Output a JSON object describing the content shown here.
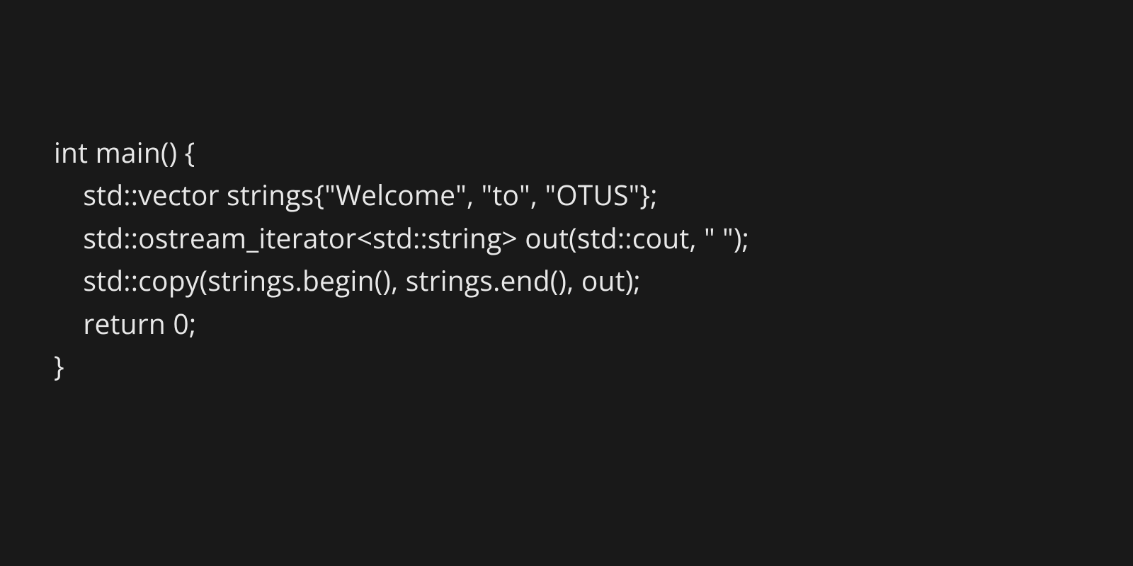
{
  "code": {
    "line1": "int main() {",
    "line2": "    std::vector strings{\"Welcome\", \"to\", \"OTUS\"};",
    "line3": "    std::ostream_iterator<std::string> out(std::cout, \" \");",
    "line4": "    std::copy(strings.begin(), strings.end(), out);",
    "line5": "    return 0;",
    "line6": "}"
  }
}
